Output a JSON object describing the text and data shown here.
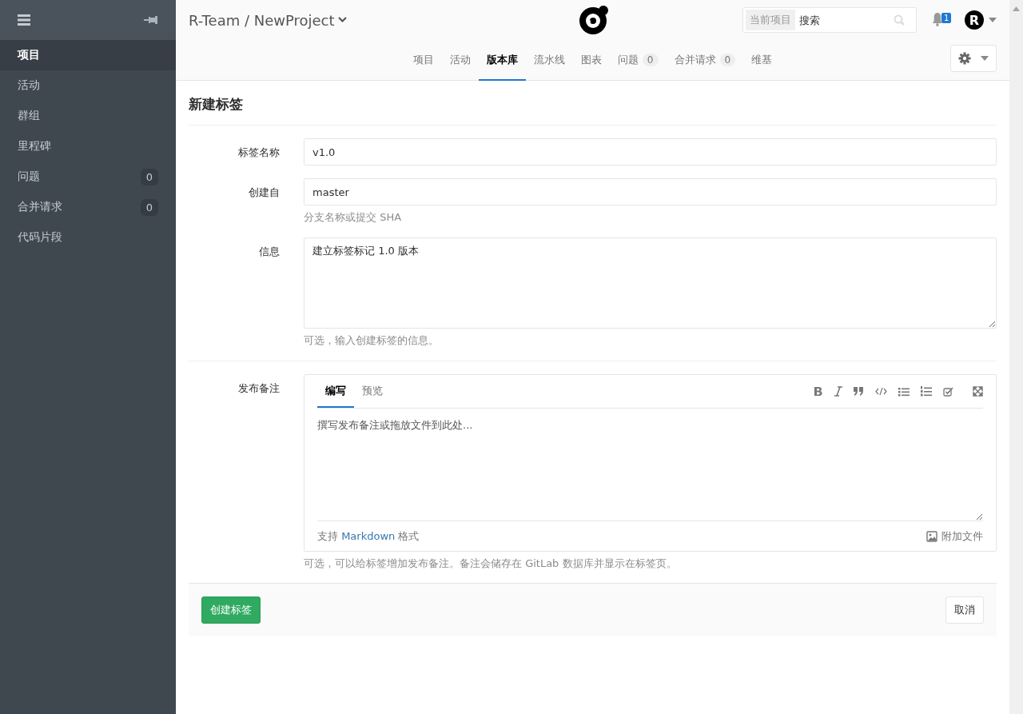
{
  "sidebar": {
    "items": [
      {
        "label": "项目",
        "selected": true
      },
      {
        "label": "活动",
        "selected": false
      },
      {
        "label": "群组",
        "selected": false
      },
      {
        "label": "里程碑",
        "selected": false
      },
      {
        "label": "问题",
        "count": "0",
        "selected": false
      },
      {
        "label": "合并请求",
        "count": "0",
        "selected": false
      },
      {
        "label": "代码片段",
        "selected": false
      }
    ]
  },
  "header": {
    "breadcrumb": "R-Team / NewProject",
    "search": {
      "scope": "当前项目",
      "placeholder": "搜索"
    },
    "notifications": "1",
    "avatar": "R"
  },
  "nav_tabs": [
    {
      "label": "项目",
      "selected": false
    },
    {
      "label": "活动",
      "selected": false
    },
    {
      "label": "版本库",
      "selected": true
    },
    {
      "label": "流水线",
      "selected": false
    },
    {
      "label": "图表",
      "selected": false
    },
    {
      "label": "问题",
      "count": "0",
      "selected": false
    },
    {
      "label": "合并请求",
      "count": "0",
      "selected": false
    },
    {
      "label": "维基",
      "selected": false
    }
  ],
  "form": {
    "title": "新建标签",
    "fields": [
      {
        "kind": "input",
        "label": "标签名称",
        "value": "v1.0"
      },
      {
        "kind": "input",
        "label": "创建自",
        "value": "master",
        "hint": "分支名称或提交 SHA"
      },
      {
        "kind": "textarea",
        "label": "信息",
        "value": "建立标签标记 1.0 版本",
        "hint": "可选，输入创建标签的信息。"
      },
      {
        "kind": "editor",
        "label": "发布备注",
        "hint": "可选，可以给标签增加发布备注。备注会储存在 GitLab 数据库并显示在标签页。",
        "tabs": [
          {
            "label": "编写",
            "selected": true
          },
          {
            "label": "预览",
            "selected": false
          }
        ],
        "placeholder": "撰写发布备注或拖放文件到此处...",
        "footer_prefix": "支持",
        "footer_link": "Markdown",
        "footer_suffix": "格式",
        "attach": "附加文件"
      }
    ],
    "submit": "创建标签",
    "cancel": "取消"
  }
}
